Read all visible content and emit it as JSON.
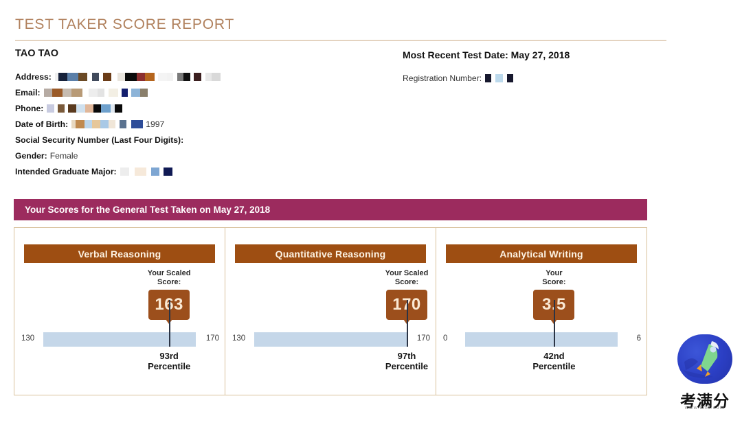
{
  "report": {
    "title": "TEST TAKER SCORE REPORT",
    "test_taker_name": "TAO TAO",
    "most_recent_test_date_label": "Most Recent Test Date: May 27, 2018",
    "registration_number_label": "Registration Number:",
    "scores_banner": "Your Scores for the General Test Taken on May 27, 2018"
  },
  "identity": {
    "rows": [
      {
        "label": "Address:",
        "value": "",
        "redacted": true
      },
      {
        "label": "Email:",
        "value": "",
        "redacted": true
      },
      {
        "label": "Phone:",
        "value": "",
        "redacted": true
      },
      {
        "label": "Date of Birth:",
        "value": "1997",
        "redacted": true
      },
      {
        "label": "Social Security Number (Last Four Digits):",
        "value": "",
        "redacted": false
      },
      {
        "label": "Gender:",
        "value": "Female",
        "redacted": false
      },
      {
        "label": "Intended Graduate Major:",
        "value": "",
        "redacted": true
      }
    ]
  },
  "chart_data": {
    "type": "bar",
    "title": "Your Scores for the General Test Taken on May 27, 2018",
    "categories": [
      "Verbal Reasoning",
      "Quantitative Reasoning",
      "Analytical Writing"
    ],
    "series": [
      {
        "name": "Scaled Score",
        "values": [
          163,
          170,
          3.5
        ]
      },
      {
        "name": "Percentile",
        "values": [
          93,
          97,
          42
        ]
      }
    ],
    "panels": [
      {
        "section": "Verbal Reasoning",
        "score_caption": "Your Scaled Score:",
        "score": "163",
        "scale_min": "130",
        "scale_max": "170",
        "scale_range": [
          130,
          170
        ],
        "marker_percent": 82.5,
        "percentile_number": "93rd",
        "percentile_word": "Percentile"
      },
      {
        "section": "Quantitative Reasoning",
        "score_caption": "Your Scaled Score:",
        "score": "170",
        "scale_min": "130",
        "scale_max": "170",
        "scale_range": [
          130,
          170
        ],
        "marker_percent": 100,
        "percentile_number": "97th",
        "percentile_word": "Percentile"
      },
      {
        "section": "Analytical Writing",
        "score_caption": "Your Score:",
        "score": "3.5",
        "scale_min": "0",
        "scale_max": "6",
        "scale_range": [
          0,
          6
        ],
        "marker_percent": 58.3,
        "percentile_number": "42nd",
        "percentile_word": "Percentile"
      }
    ],
    "xlabel": "",
    "ylabel": "",
    "grid": false,
    "legend": "none"
  },
  "colors": {
    "title": "#b0805c",
    "rule": "#c9a882",
    "banner": "#9c2b5e",
    "panel_header": "#9e4e12",
    "score_box": "#9c4f1c",
    "score_text": "#fae9d4",
    "scale_bar": "#c5d7e9",
    "marker": "#2b3445",
    "frame_border": "#d8c09a"
  },
  "watermark": {
    "name": "考满分",
    "url": "www.kmf.com"
  },
  "redactions": {
    "address": [
      "#efefef",
      "#16213a",
      "#5b7fa8",
      "#6b4a25",
      "#ffffff",
      "#414a5c",
      "#ffffff",
      "#6b3c17",
      "#ffffff",
      "#e9e5de",
      "#0b0b0b",
      "#8c2f2f",
      "#b5651d",
      "#ffffff",
      "#f4f4f4",
      "#f2f2f2",
      "#ffffff",
      "#7a7a7a",
      "#111111",
      "#ffffff",
      "#3b1f1f",
      "#ffffff",
      "#e8e8e8",
      "#d9d9d9"
    ],
    "email": [
      "#b6aba3",
      "#9a5a28",
      "#c6bbb0",
      "#b89a76",
      "#ffffff",
      "#ededed",
      "#e3e3e3",
      "#ffffff",
      "#f3efe4",
      "#ffffff",
      "#141f6e",
      "#ffffff",
      "#8db4d8",
      "#8a7f6b"
    ],
    "phone": [
      "#c8cbe0",
      "#ffffff",
      "#7a5a3a",
      "#ffffff",
      "#5a3a1e",
      "#cfe0ee",
      "#e0b79a",
      "#0a0a0a",
      "#6ea0cc",
      "#dfe7ef",
      "#0a0a0a"
    ],
    "dob": [
      "#e8d8c0",
      "#c08a50",
      "#bcd6ec",
      "#e6c79a",
      "#a9c9e6",
      "#f0e6d8",
      "#ffffff",
      "#5b7390",
      "#ffffff",
      "#2e4d99"
    ],
    "registration": [
      "#17182e",
      "#ffffff",
      "#bcd9ec",
      "#ffffff",
      "#17182e"
    ],
    "major": [
      "#ededed",
      "#ffffff",
      "#f6e9da",
      "#ffffff",
      "#7ea6d2",
      "#ffffff",
      "#101a54"
    ]
  }
}
